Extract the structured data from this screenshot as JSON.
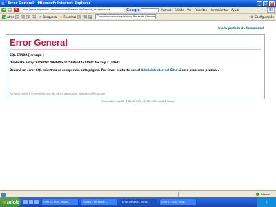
{
  "window": {
    "title": "Error General - Microsoft Internet Explorer",
    "buttons": [
      "_",
      "□",
      "×"
    ]
  },
  "address_bar": {
    "url": "http://www.fospassim.com/comunidad/search.php?search_id=egosearch",
    "google_label": "Google",
    "search_text": "Chandler nominating/winning Bocas de Chandler",
    "menu": [
      "Archivo",
      "Edición",
      "Ver",
      "Favoritos",
      "Herramientas",
      "Ayuda"
    ]
  },
  "toolbar": {
    "back_label": "Atrás",
    "search_label": "Búsqueda",
    "favorites_label": "Favoritos",
    "links_text": "Chandler nominating/winning Bocas de Chandler",
    "config_label": "Configuración"
  },
  "page": {
    "top_nav_link": "Ir a la portada de Comunidad",
    "error_title": "Error General",
    "sql_error_line": "SQL ERROR [ mysql4 ]",
    "duplicate_line": "Duplicate entry 'baf98f3c20643f8e1f25b8ab78a1253f' for key 1 [1062]",
    "message_prefix": "Ocurrió un error SQL mientras se recuperaba esta página. Por favor contacte con el",
    "admin_link": "Administrador del Sitio",
    "message_suffix": "si este problema persiste.",
    "footer_note": "Por favor notifica al administrador del sitio o webmaster: foopasana@msp.com",
    "powered_by": "Powered by phpBB © 2000, 2002, 2005, 2007 phpBB Group"
  },
  "status_bar": {
    "zone": "Internet"
  },
  "taskbar": {
    "start_label": "Inicio",
    "tasks": [
      "Gem EL FAIS - Micro...",
      "Google - Microsoft I...",
      "Error General - Micro...",
      "Gem EL FAIS - Hisp..."
    ],
    "clock": "?"
  }
}
